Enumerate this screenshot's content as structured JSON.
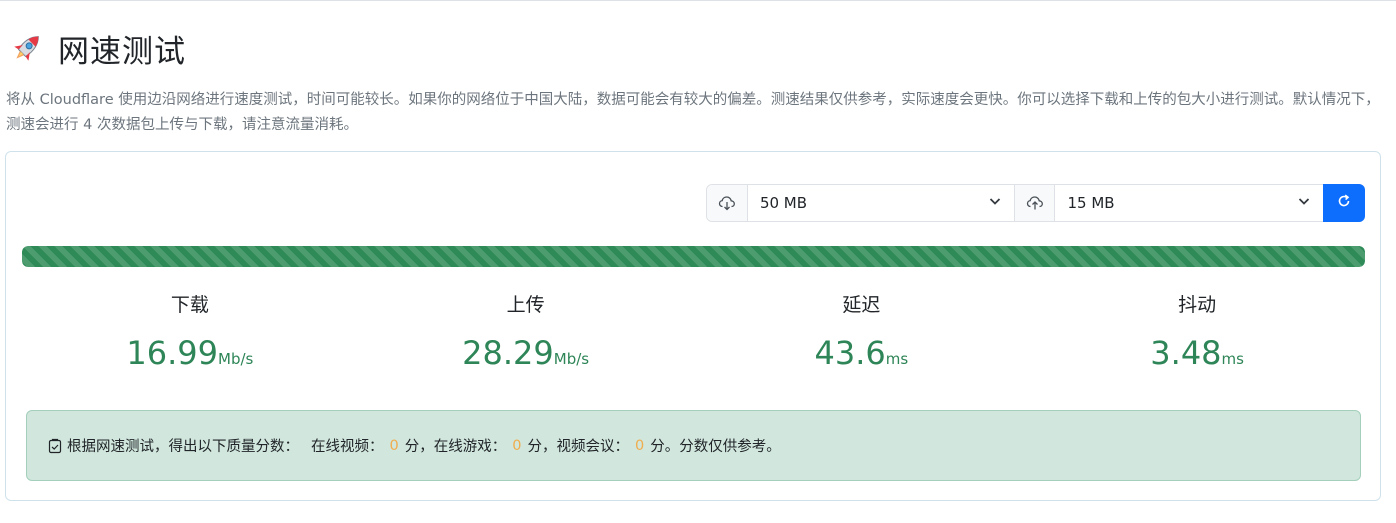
{
  "header": {
    "title": "网速测试",
    "icon": "rocket-icon"
  },
  "description": "将从 Cloudflare 使用边沿网络进行速度测试，时间可能较长。如果你的网络位于中国大陆，数据可能会有较大的偏差。测速结果仅供参考，实际速度会更快。你可以选择下载和上传的包大小进行测试。默认情况下，测速会进行 4 次数据包上传与下载，请注意流量消耗。",
  "controls": {
    "download_size": "50 MB",
    "upload_size": "15 MB"
  },
  "progress": {
    "percent": 100,
    "color": "#2e8b57"
  },
  "metrics": [
    {
      "label": "下载",
      "value": "16.99",
      "unit": "Mb/s"
    },
    {
      "label": "上传",
      "value": "28.29",
      "unit": "Mb/s"
    },
    {
      "label": "延迟",
      "value": "43.6",
      "unit": "ms"
    },
    {
      "label": "抖动",
      "value": "3.48",
      "unit": "ms"
    }
  ],
  "score": {
    "intro": "根据网速测试，得出以下质量分数：",
    "video_label": "在线视频：",
    "video_score": "0",
    "game_label": "分，在线游戏：",
    "game_score": "0",
    "meeting_label": "分，视频会议：",
    "meeting_score": "0",
    "outro": "分。分数仅供参考。"
  },
  "colors": {
    "accent": "#0d6efd",
    "value_green": "#2e8557",
    "score_zero": "#f0ad4e"
  }
}
